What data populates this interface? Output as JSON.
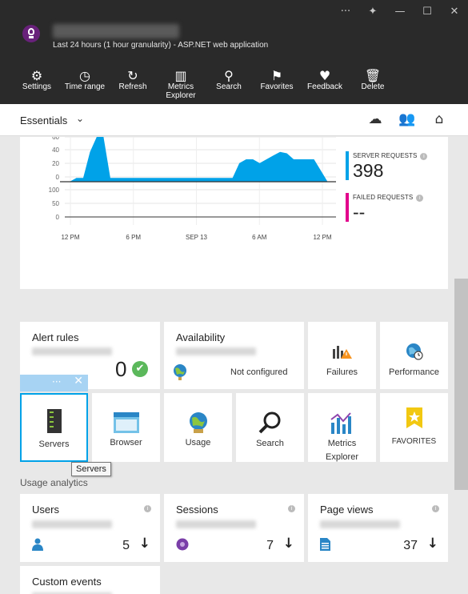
{
  "header": {
    "subtitle": "Last 24 hours (1 hour granularity) - ASP.NET web application",
    "window_controls": [
      "···",
      "✦",
      "—",
      "☐",
      "✕"
    ],
    "toolbar": [
      {
        "label": "Settings",
        "icon": "⚙",
        "name": "settings"
      },
      {
        "label": "Time range",
        "icon": "◷",
        "name": "time-range"
      },
      {
        "label": "Refresh",
        "icon": "↻",
        "name": "refresh"
      },
      {
        "label": "Metrics Explorer",
        "icon": "▥",
        "name": "metrics-explorer"
      },
      {
        "label": "Search",
        "icon": "⚲",
        "name": "search"
      },
      {
        "label": "Favorites",
        "icon": "⚑",
        "name": "favorites"
      },
      {
        "label": "Feedback",
        "icon": "♥",
        "name": "feedback"
      },
      {
        "label": "Delete",
        "icon": "🗑",
        "name": "delete"
      }
    ]
  },
  "essentials": {
    "label": "Essentials",
    "chevron": "⌄"
  },
  "chart_data": {
    "type": "area",
    "x_ticks": [
      "12 PM",
      "6 PM",
      "SEP 13",
      "6 AM",
      "12 PM"
    ],
    "top_y_ticks": [
      "60",
      "40",
      "20",
      "0"
    ],
    "bottom_y_ticks": [
      "100",
      "50",
      "0"
    ],
    "series": [
      {
        "name": "SERVER REQUESTS",
        "color": "#00a2e8",
        "values": [
          0,
          5,
          5,
          40,
          75,
          90,
          5,
          5,
          5,
          5,
          5,
          5,
          5,
          5,
          5,
          5,
          5,
          5,
          5,
          5,
          5,
          5,
          5,
          5,
          5,
          25,
          30,
          30,
          25,
          30,
          35,
          40,
          38,
          30,
          30,
          30,
          30,
          15,
          0,
          0
        ]
      },
      {
        "name": "FAILED REQUESTS",
        "color": "#e3008c",
        "values": []
      }
    ],
    "kpis": [
      {
        "label": "SERVER REQUESTS",
        "value": "398",
        "color": "#00a2e8"
      },
      {
        "label": "FAILED REQUESTS",
        "value": "--",
        "color": "#e3008c"
      }
    ]
  },
  "tiles": {
    "alert_rules": {
      "title": "Alert rules",
      "count": "0"
    },
    "availability": {
      "title": "Availability",
      "status": "Not configured"
    },
    "failures": {
      "label": "Failures"
    },
    "performance": {
      "label": "Performance"
    },
    "servers": {
      "label": "Servers",
      "tooltip": "Servers"
    },
    "browser": {
      "label": "Browser"
    },
    "usage": {
      "label": "Usage"
    },
    "search": {
      "label": "Search"
    },
    "metrics": {
      "label": "Metrics Explorer"
    },
    "favorites": {
      "label": "FAVORITES"
    }
  },
  "usage_analytics": {
    "title": "Usage analytics",
    "items": [
      {
        "title": "Users",
        "value": "5"
      },
      {
        "title": "Sessions",
        "value": "7"
      },
      {
        "title": "Page views",
        "value": "37"
      },
      {
        "title": "Custom events"
      }
    ]
  },
  "colors": {
    "accent": "#00a2e8",
    "failed": "#e3008c",
    "header_bg": "#2a2a2a",
    "ok_green": "#5bb85b"
  }
}
